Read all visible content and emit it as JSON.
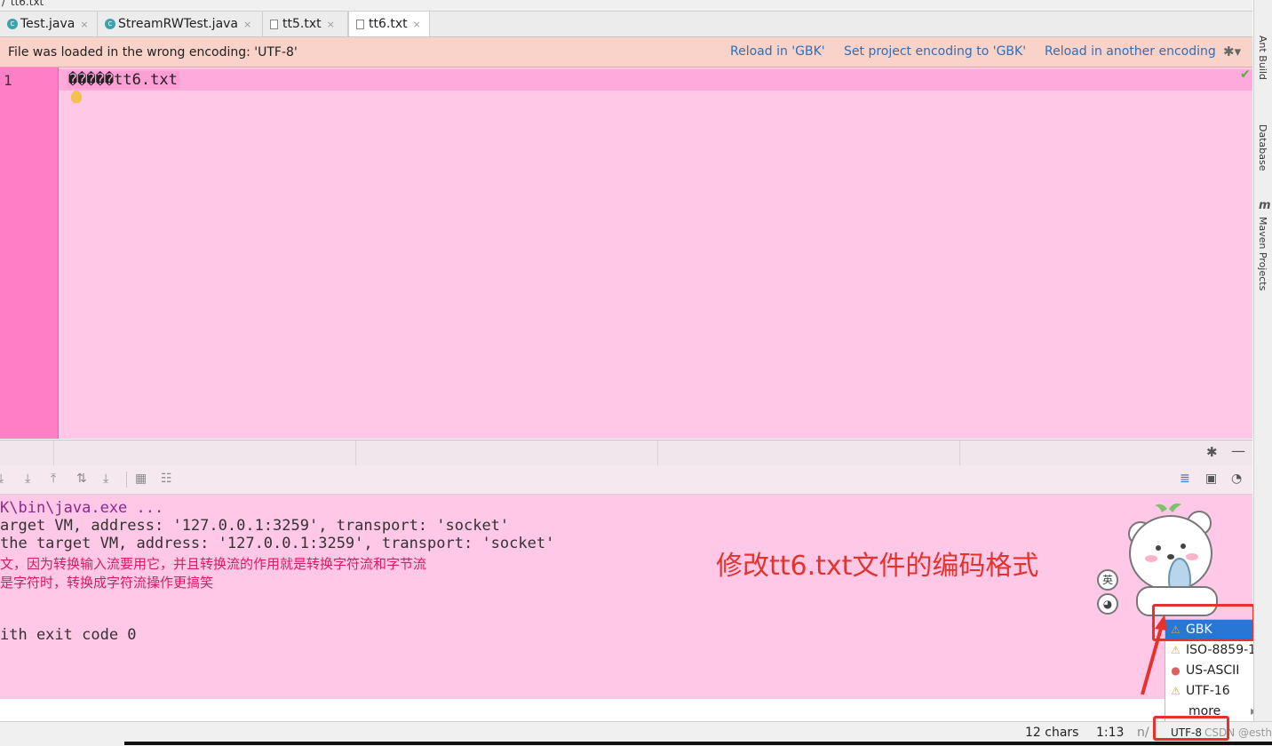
{
  "breadcrumb": {
    "sep": "/",
    "file": "tt6.txt"
  },
  "tabs": [
    {
      "label": "Test.java",
      "icon": "java-class-icon",
      "closable": true
    },
    {
      "label": "StreamRWTest.java",
      "icon": "java-class-icon",
      "closable": true
    },
    {
      "label": "tt5.txt",
      "icon": "text-file-icon",
      "closable": true
    },
    {
      "label": "tt6.txt",
      "icon": "text-file-icon",
      "closable": true,
      "active": true
    }
  ],
  "tab_close_glyph": "×",
  "java_icon_glyph": "c",
  "encoding_warning": {
    "message": "File was loaded in the wrong encoding: 'UTF-8'",
    "actions": [
      "Reload in 'GBK'",
      "Set project encoding to 'GBK'",
      "Reload in another encoding"
    ],
    "gear_glyph": "✱▾",
    "background": "#f9d2c9"
  },
  "editor": {
    "line_number": "1",
    "line_text": "�����tt6.txt",
    "check_glyph": "✔",
    "background": "#ffc8e6"
  },
  "tool_window": {
    "gear_glyph": "✱",
    "minimize_glyph": "—",
    "toolbar_glyphs": [
      "⤓",
      "⤓",
      "⤒",
      "⇅",
      "⤓",
      "▦",
      "☷"
    ],
    "right_glyphs": [
      "≣",
      "▣",
      "◔"
    ]
  },
  "console": {
    "lines": [
      {
        "text": "K\\bin\\java.exe ...",
        "style": "purple"
      },
      {
        "text": "arget VM, address: '127.0.0.1:3259', transport: 'socket'",
        "style": "normal"
      },
      {
        "text": "the target VM, address: '127.0.0.1:3259', transport: 'socket'",
        "style": "normal"
      },
      {
        "text": "文，因为转换输入流要用它，并且转换流的作用就是转换字符流和字节流",
        "style": "red"
      },
      {
        "text": "是字符时，转换成字符流操作更搞笑",
        "style": "red"
      },
      {
        "text": "ith exit code 0",
        "style": "normal"
      }
    ],
    "annotation": "修改tt6.txt文件的编码格式"
  },
  "ime": {
    "badge1": "英",
    "badge2": "◕"
  },
  "encoding_popup": {
    "items": [
      {
        "label": "GBK",
        "icon": "warning-icon",
        "glyph": "⚠",
        "selected": true
      },
      {
        "label": "ISO-8859-1",
        "icon": "warning-icon",
        "glyph": "⚠"
      },
      {
        "label": "US-ASCII",
        "icon": "error-icon",
        "glyph": "●"
      },
      {
        "label": "UTF-16",
        "icon": "warning-icon",
        "glyph": "⚠"
      }
    ],
    "more_label": "more",
    "more_arrow": "▸"
  },
  "status_bar": {
    "chars": "12 chars",
    "position": "1:13",
    "line_sep": "n/",
    "encoding": "UTF-8",
    "watermark": "CSDN @esther_gu"
  },
  "right_stripe": {
    "ant": "Ant Build",
    "database": "Database",
    "maven": "Maven Projects",
    "maven_glyph": "m"
  },
  "colors": {
    "accent_link": "#2f6fb8",
    "selection": "#2678d4",
    "annotation_red": "#e5322d",
    "console_red": "#d81b60"
  }
}
